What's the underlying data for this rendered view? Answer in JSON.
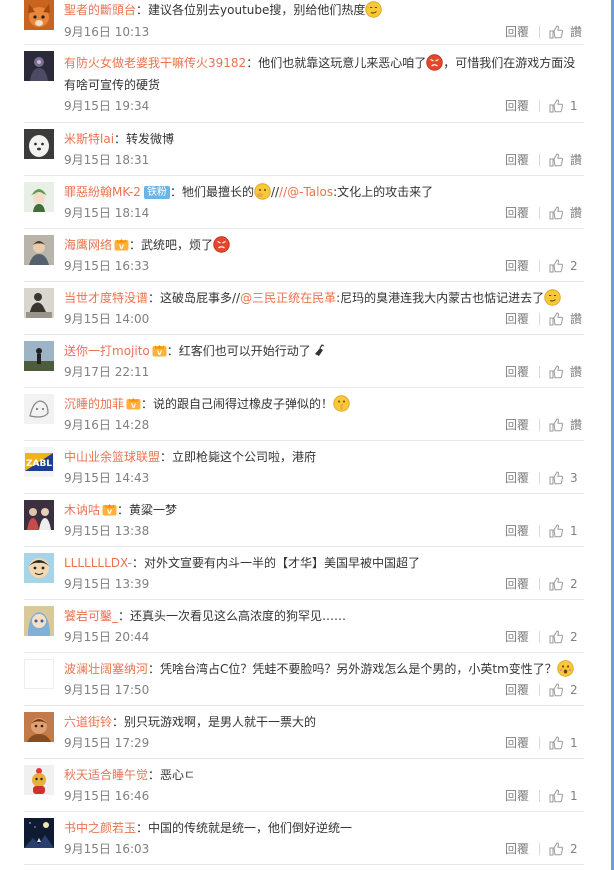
{
  "ui": {
    "reply_label": "回覆",
    "like_zero_label": "讚"
  },
  "colors": {
    "username": "#eb7350",
    "text": "#333333",
    "meta": "#808080",
    "separator": "#e7e7e7",
    "right_border": "#6b9fd7",
    "badge_blue": "#6ab4e8"
  },
  "comments": [
    {
      "user": "聖者的斷頭台",
      "text": "：建议各位别去youtube搜，别给他们热度",
      "time": "9月16日 10:13",
      "likes": "讚",
      "avatar": "fox"
    },
    {
      "user": "有防火女做老婆我干嘛传火39182",
      "text": "：他们也就靠这玩意儿来恶心咱了",
      "text2": "，可惜我们在游戏方面没有啥可宣传的硬货",
      "time": "9月15日 19:34",
      "likes": "1",
      "avatar": "dark-figure"
    },
    {
      "user": "米斯特lai",
      "text": "：转发微博",
      "time": "9月15日 18:31",
      "likes": "讚",
      "avatar": "white-dog"
    },
    {
      "user": "罪惡紛翰MK-2",
      "badge": "铁粉",
      "text": "：牠们最擅长的",
      "link": "//@-Talos",
      "text2": ":文化上的攻击来了",
      "time": "9月15日 18:14",
      "likes": "讚",
      "avatar": "green-hair"
    },
    {
      "user": "海鹰网络",
      "text": "：武统吧，烦了",
      "time": "9月15日 16:33",
      "likes": "2",
      "avatar": "person"
    },
    {
      "user": "当世才度特没谱",
      "text": "：这破岛屁事多//",
      "link": "@三民正统在民革",
      "text2": ":尼玛的臭港连我大内蒙古也惦记进去了",
      "time": "9月15日 14:00",
      "likes": "讚",
      "avatar": "sitting-person"
    },
    {
      "user": "送你一打mojito",
      "text": "：红客们也可以开始行动了",
      "time": "9月17日 22:11",
      "likes": "讚",
      "avatar": "silhouette"
    },
    {
      "user": "沉睡的加菲",
      "text": "：说的跟自己闹得过橡皮子弹似的！",
      "time": "9月16日 14:28",
      "likes": "讚",
      "avatar": "sketch"
    },
    {
      "user": "中山业余篮球联盟",
      "text": "：立即枪毙这个公司啦，港府",
      "time": "9月15日 14:43",
      "likes": "3",
      "avatar": "logo",
      "avatar_text": "ZABL"
    },
    {
      "user": "木讷咕",
      "text": "：黄粱一梦",
      "time": "9月15日 13:38",
      "likes": "1",
      "avatar": "group"
    },
    {
      "user": "LLLLLLLDX-",
      "text": "：对外文宣要有内斗一半的【才华】美国早被中国超了",
      "time": "9月15日 13:39",
      "likes": "2",
      "avatar": "cartoon"
    },
    {
      "user": "饕岩可鑿_",
      "text": "：还真头一次看见这么高浓度的狗罕见……",
      "time": "9月15日 20:44",
      "likes": "2",
      "avatar": "anime"
    },
    {
      "user": "波澜壮阔塞纳河",
      "text": "：凭啥台湾占C位？凭蛙不要脸吗？另外游戏怎么是个男的，小英tm变性了？",
      "time": "9月15日 17:50",
      "likes": "2",
      "avatar": "blank"
    },
    {
      "user": "六道街铃",
      "text": "：别只玩游戏啊，是男人就干一票大的",
      "time": "9月15日 17:29",
      "likes": "1",
      "avatar": "muscle"
    },
    {
      "user": "秋天适合睡午觉",
      "text": "：恶心ㄷ",
      "time": "9月15日 16:46",
      "likes": "1",
      "avatar": "toy"
    },
    {
      "user": "书中之颜若玉",
      "text": "：中国的传统就是统一，他们倒好逆统一",
      "time": "9月15日 16:03",
      "likes": "2",
      "avatar": "night"
    }
  ]
}
